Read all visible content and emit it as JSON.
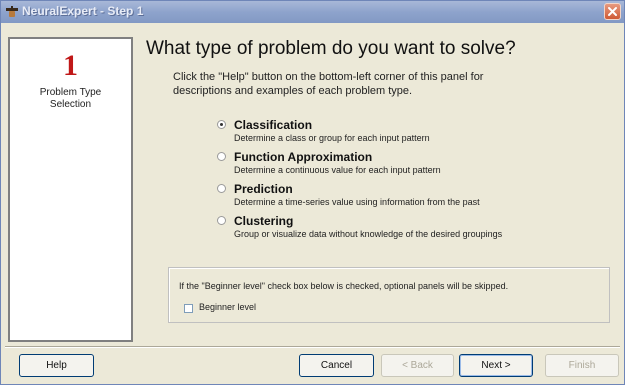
{
  "window": {
    "title": "NeuralExpert - Step 1",
    "close_label": "×"
  },
  "sidebar": {
    "step_number": "1",
    "step_label_1": "Problem Type",
    "step_label_2": "Selection"
  },
  "main": {
    "title": "What type of problem do you want to solve?",
    "intro_line1": "Click the \"Help\" button on the bottom-left corner of this panel for",
    "intro_line2": "descriptions and examples of each problem type."
  },
  "options": [
    {
      "label": "Classification",
      "description": "Determine a class or group for each input pattern",
      "checked": true
    },
    {
      "label": "Function Approximation",
      "description": "Determine a continuous value for each input pattern",
      "checked": false
    },
    {
      "label": "Prediction",
      "description": "Determine a time-series value using information from the past",
      "checked": false
    },
    {
      "label": "Clustering",
      "description": "Group or visualize data without knowledge of the desired groupings",
      "checked": false
    }
  ],
  "beginner": {
    "note": "If the \"Beginner level\" check box below is checked, optional panels will be skipped.",
    "checkbox_label": "Beginner level",
    "checked": false
  },
  "buttons": {
    "help": "Help",
    "cancel": "Cancel",
    "back": "< Back",
    "next": "Next >",
    "finish": "Finish"
  },
  "colors": {
    "title_bar": "#8ea3cc",
    "step_number": "#c01818",
    "close_button": "#cf5a35"
  }
}
